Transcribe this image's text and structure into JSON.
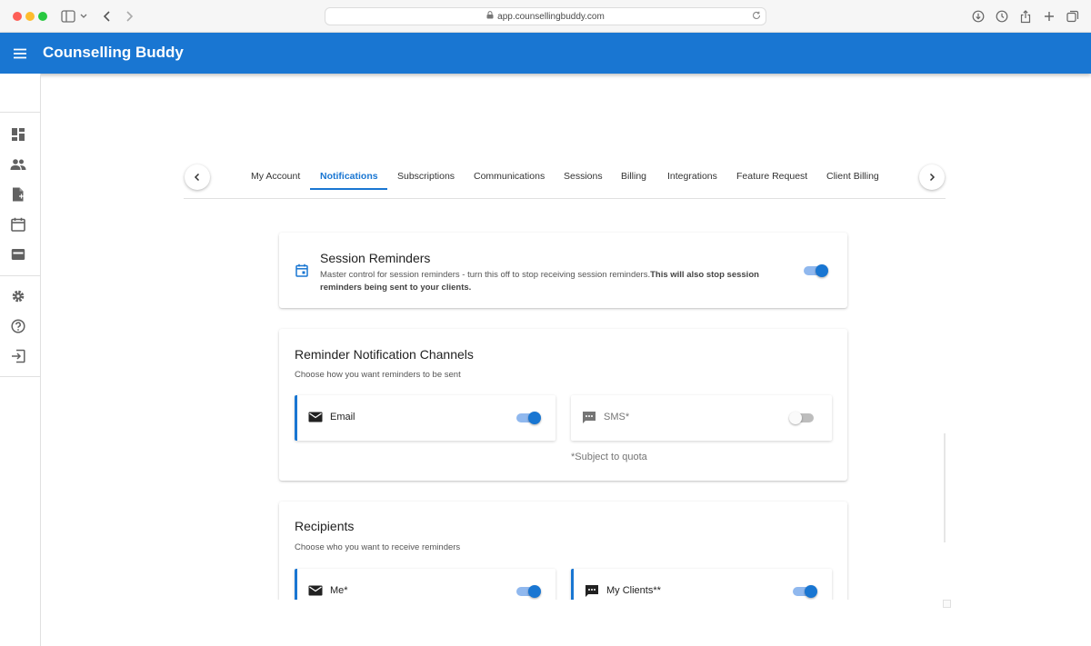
{
  "browser": {
    "url": "app.counsellingbuddy.com"
  },
  "app": {
    "title": "Counselling Buddy"
  },
  "sidebar": {
    "items": [
      {
        "icon": "dashboard-icon"
      },
      {
        "icon": "people-icon"
      },
      {
        "icon": "document-icon"
      },
      {
        "icon": "calendar-icon"
      },
      {
        "icon": "wallet-icon"
      },
      {
        "icon": "gear-icon"
      },
      {
        "icon": "help-icon"
      },
      {
        "icon": "logout-icon"
      }
    ]
  },
  "tabs": {
    "items": [
      "My Account",
      "Notifications",
      "Subscriptions",
      "Communications",
      "Sessions",
      "Billing",
      "Integrations",
      "Feature Request",
      "Client Billing"
    ],
    "active": "Notifications"
  },
  "session_reminders": {
    "title": "Session Reminders",
    "description": "Master control for session reminders - turn this off to stop receiving session reminders.",
    "description_bold": "This will also stop session reminders being sent to your clients.",
    "enabled": true
  },
  "channels": {
    "title": "Reminder Notification Channels",
    "subtitle": "Choose how you want reminders to be sent",
    "email_label": "Email",
    "email_enabled": true,
    "sms_label": "SMS*",
    "sms_enabled": false,
    "quota_note": "*Subject to quota"
  },
  "recipients": {
    "title": "Recipients",
    "subtitle": "Choose who you want to receive reminders",
    "me_label": "Me*",
    "me_enabled": true,
    "clients_label": "My Clients**",
    "clients_enabled": true
  },
  "colors": {
    "primary": "#1976d2",
    "toggle_track_on": "#90b8ee"
  }
}
